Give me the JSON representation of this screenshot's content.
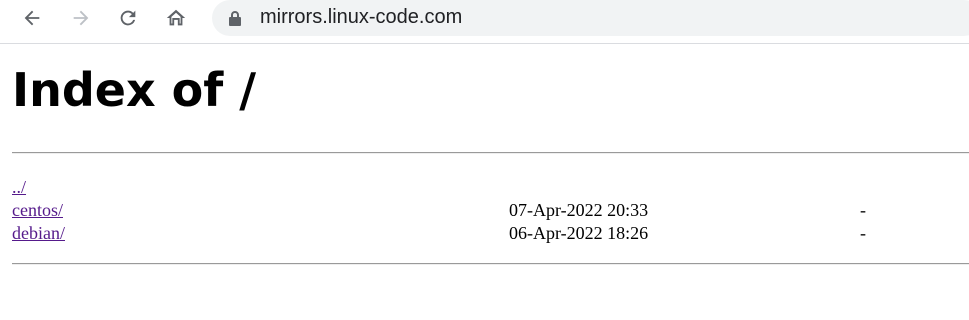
{
  "browser": {
    "url": "mirrors.linux-code.com",
    "icons": {
      "back": "arrow-left-icon",
      "forward": "arrow-right-icon",
      "reload": "reload-icon",
      "home": "home-icon",
      "lock": "lock-icon"
    }
  },
  "page": {
    "title": "Index of /",
    "entries": [
      {
        "name": "../",
        "date": "",
        "size": ""
      },
      {
        "name": "centos/",
        "date": "07-Apr-2022 20:33",
        "size": "-"
      },
      {
        "name": "debian/",
        "date": "06-Apr-2022 18:26",
        "size": "-"
      }
    ]
  },
  "colors": {
    "link_visited": "#551a8b",
    "omnibox_bg": "#f1f3f4",
    "icon": "#5f6368"
  }
}
